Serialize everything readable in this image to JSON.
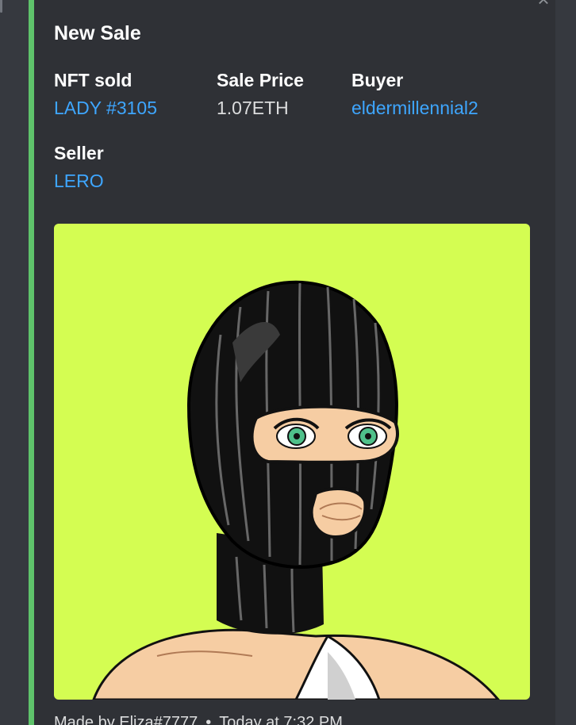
{
  "embed": {
    "accent_color": "#5fc36b",
    "title": "New Sale",
    "fields": [
      {
        "name": "NFT sold",
        "value": "LADY #3105",
        "is_link": true
      },
      {
        "name": "Sale Price",
        "value": "1.07ETH",
        "is_link": false
      },
      {
        "name": "Buyer",
        "value": "eldermillennial2",
        "is_link": true
      },
      {
        "name": "Seller",
        "value": "LERO",
        "is_link": true
      }
    ],
    "image": {
      "background_color": "#d4fd52"
    },
    "footer": {
      "author": "Made by Eliza#7777",
      "separator": "•",
      "timestamp": "Today at 7:32 PM"
    }
  },
  "controls": {
    "close_icon": "close-icon",
    "close_glyph": "×"
  }
}
